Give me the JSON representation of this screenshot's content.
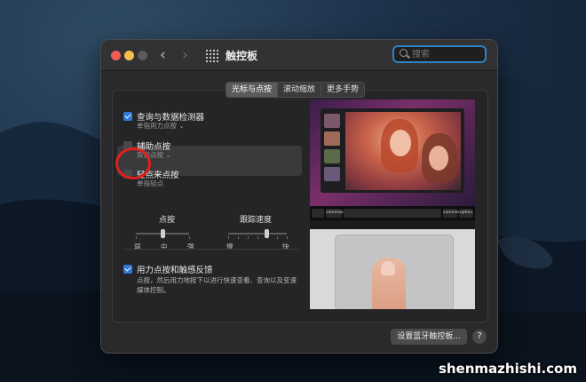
{
  "window": {
    "title": "触控板",
    "search_placeholder": "搜索"
  },
  "tabs": [
    {
      "label": "光标与点按",
      "active": true
    },
    {
      "label": "滚动缩放",
      "active": false
    },
    {
      "label": "更多手势",
      "active": false
    }
  ],
  "options": {
    "lookup": {
      "label": "查询与数据检测器",
      "sub": "单指用力点按",
      "checked": true
    },
    "secondary_click": {
      "label": "辅助点按",
      "sub": "双指点按",
      "checked": false
    },
    "tap_to_click": {
      "label": "轻点来点按",
      "sub": "单指轻点",
      "checked": false
    },
    "force_click": {
      "label": "用力点按和触感反馈",
      "checked": true,
      "description": "点按，然后用力地按下以进行快速查看、查询以及变速媒体控制。"
    }
  },
  "sliders": {
    "click": {
      "title": "点按",
      "min_label": "弱",
      "mid_label": "中",
      "max_label": "强",
      "value": 0.5
    },
    "tracking_speed": {
      "title": "跟踪速度",
      "min_label": "慢",
      "max_label": "快",
      "value": 0.65
    }
  },
  "preview_touchbar": [
    "command",
    "command",
    "option"
  ],
  "footer": {
    "bluetooth_button": "设置蓝牙触控板...",
    "help": "?"
  },
  "watermark": "shenmazhishi.com",
  "colors": {
    "accent": "#2f7ad8",
    "annotation_circle": "#e0201c"
  }
}
